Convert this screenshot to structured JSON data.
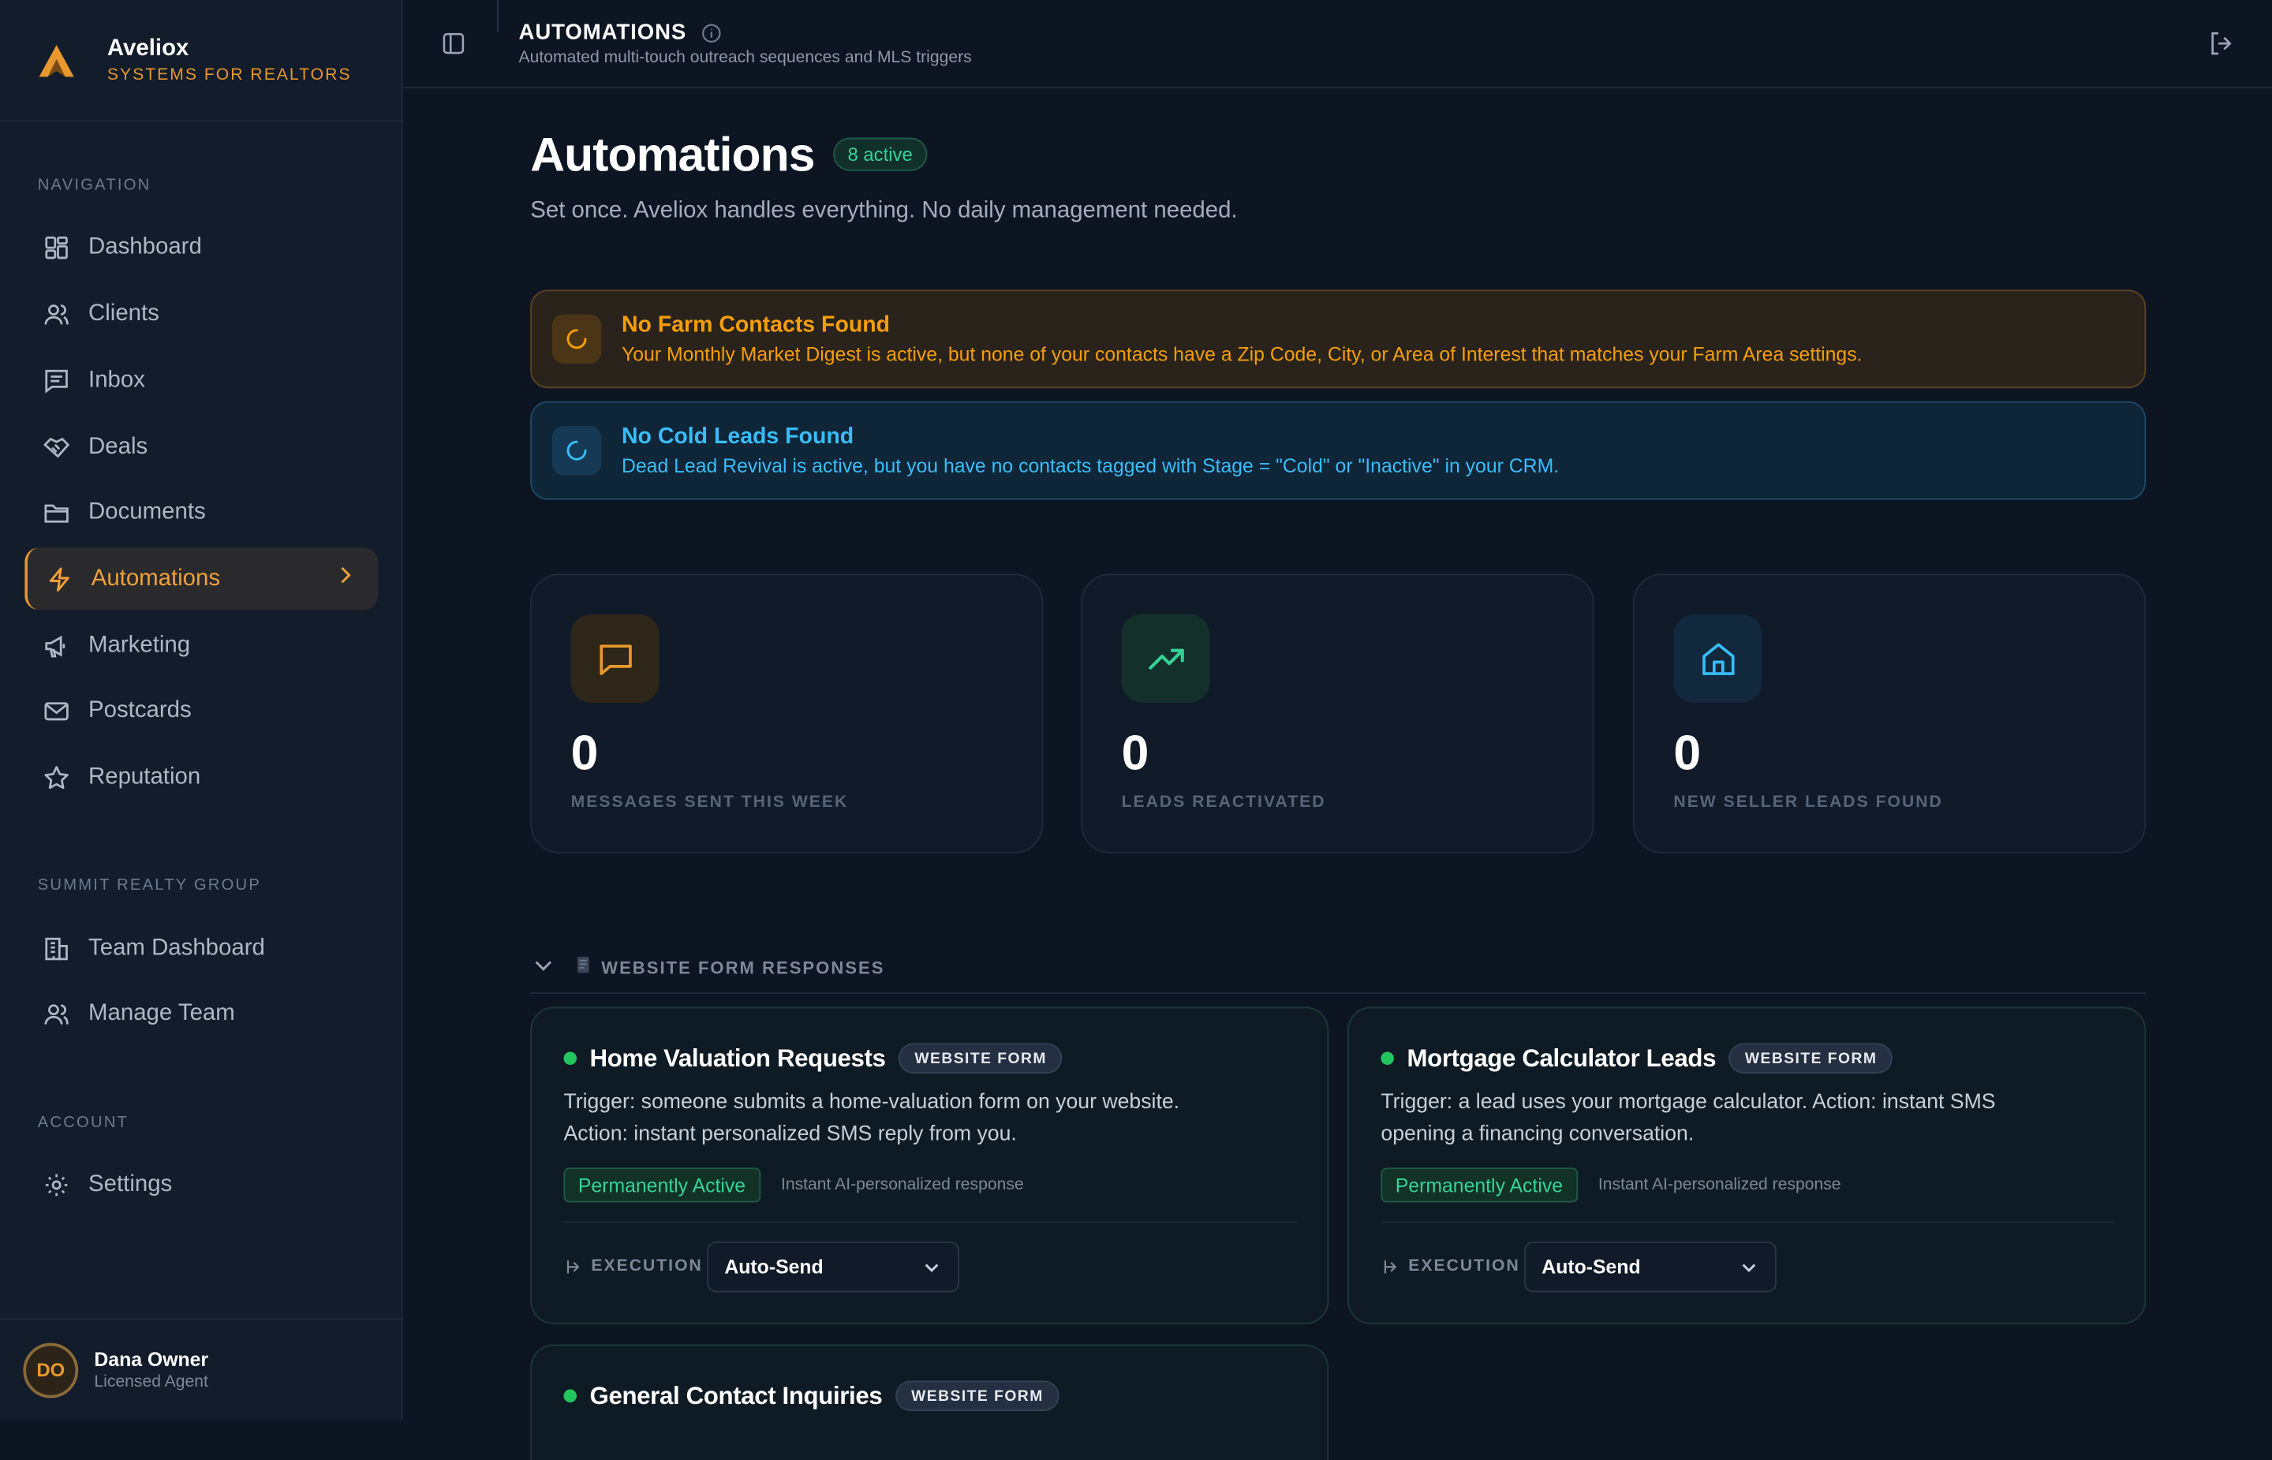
{
  "brand": {
    "name": "Aveliox",
    "tagline": "SYSTEMS FOR REALTORS"
  },
  "sidebar": {
    "navigation_label": "NAVIGATION",
    "nav": [
      {
        "label": "Dashboard",
        "icon": "dashboard-icon"
      },
      {
        "label": "Clients",
        "icon": "users-icon"
      },
      {
        "label": "Inbox",
        "icon": "message-icon"
      },
      {
        "label": "Deals",
        "icon": "handshake-icon"
      },
      {
        "label": "Documents",
        "icon": "folder-icon"
      },
      {
        "label": "Automations",
        "icon": "lightning-icon",
        "active": true
      },
      {
        "label": "Marketing",
        "icon": "megaphone-icon"
      },
      {
        "label": "Postcards",
        "icon": "mail-icon"
      },
      {
        "label": "Reputation",
        "icon": "star-icon"
      }
    ],
    "team_label": "SUMMIT REALTY GROUP",
    "team": [
      {
        "label": "Team Dashboard",
        "icon": "building-icon"
      },
      {
        "label": "Manage Team",
        "icon": "users-icon"
      }
    ],
    "account_label": "ACCOUNT",
    "account": [
      {
        "label": "Settings",
        "icon": "gear-icon"
      }
    ]
  },
  "user": {
    "initials": "DO",
    "name": "Dana Owner",
    "role": "Licensed Agent"
  },
  "topbar": {
    "title": "AUTOMATIONS",
    "subtitle": "Automated multi-touch outreach sequences and MLS triggers"
  },
  "page": {
    "title": "Automations",
    "active_badge": "8 active",
    "subtitle": "Set once. Aveliox handles everything. No daily management needed."
  },
  "alerts": [
    {
      "title": "No Farm Contacts Found",
      "text": "Your Monthly Market Digest is active, but none of your contacts have a Zip Code, City, or Area of Interest that matches your Farm Area settings.",
      "color": "#f59e0b"
    },
    {
      "title": "No Cold Leads Found",
      "text": "Dead Lead Revival is active, but you have no contacts tagged with Stage = \"Cold\" or \"Inactive\" in your CRM.",
      "color": "#38bdf8"
    }
  ],
  "stats": [
    {
      "value": "0",
      "label": "MESSAGES SENT THIS WEEK",
      "icon": "chat-bubble-icon",
      "color": "#e8982c"
    },
    {
      "value": "0",
      "label": "LEADS REACTIVATED",
      "icon": "trending-up-icon",
      "color": "#34d399"
    },
    {
      "value": "0",
      "label": "NEW SELLER LEADS FOUND",
      "icon": "home-icon",
      "color": "#38bdf8"
    }
  ],
  "group": {
    "label": "WEBSITE FORM RESPONSES"
  },
  "cards": [
    {
      "name": "Home Valuation Requests",
      "badge": "WEBSITE FORM",
      "description": "Trigger: someone submits a home-valuation form on your website. Action: instant personalized SMS reply from you.",
      "status": "Permanently Active",
      "hint": "Instant AI-personalized response",
      "execution_label": "EXECUTION",
      "execution_value": "Auto-Send"
    },
    {
      "name": "Mortgage Calculator Leads",
      "badge": "WEBSITE FORM",
      "description": "Trigger: a lead uses your mortgage calculator. Action: instant SMS opening a financing conversation.",
      "status": "Permanently Active",
      "hint": "Instant AI-personalized response",
      "execution_label": "EXECUTION",
      "execution_value": "Auto-Send"
    },
    {
      "name": "General Contact Inquiries",
      "badge": "WEBSITE FORM"
    }
  ]
}
